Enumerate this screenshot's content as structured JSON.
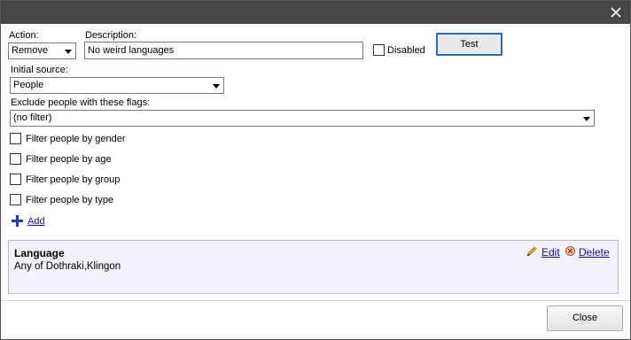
{
  "window": {
    "close_icon": "close-icon"
  },
  "form": {
    "action_label": "Action:",
    "action_value": "Remove",
    "description_label": "Description:",
    "description_value": "No weird languages",
    "disabled_label": "Disabled",
    "disabled_checked": false,
    "test_button": "Test",
    "initial_source_label": "Initial source:",
    "initial_source_value": "People",
    "exclude_flags_label": "Exclude people with these flags:",
    "exclude_flags_value": "(no filter)",
    "filters": [
      {
        "label": "Filter people by gender",
        "checked": false
      },
      {
        "label": "Filter people by age",
        "checked": false
      },
      {
        "label": "Filter people by group",
        "checked": false
      },
      {
        "label": "Filter people by type",
        "checked": false
      }
    ],
    "add_label": "Add",
    "add_icon": "plus-icon"
  },
  "rule": {
    "title": "Language",
    "detail": "Any of Dothraki,Klingon",
    "edit_label": "Edit",
    "edit_icon": "pencil-icon",
    "delete_label": "Delete",
    "delete_icon": "delete-circle-icon"
  },
  "footer": {
    "close_button": "Close"
  },
  "colors": {
    "titlebar": "#464646",
    "link": "#1a0dab",
    "panel_bg": "#f3f3fc",
    "panel_border": "#b8b8e0",
    "add_icon": "#1c3fb7",
    "test_border": "#2a6ac8"
  }
}
